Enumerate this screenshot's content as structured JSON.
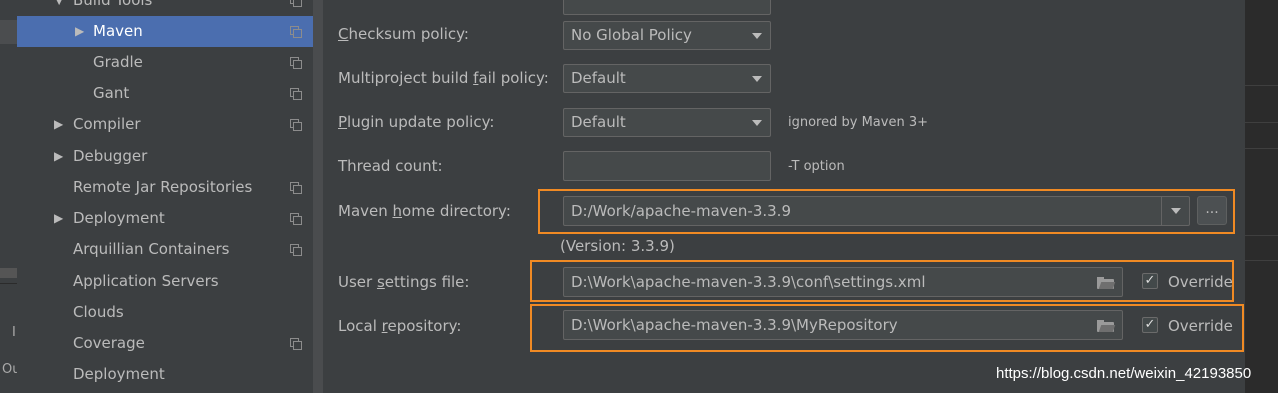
{
  "left_strip": {
    "text1": "I",
    "text2": "Ou"
  },
  "tree": {
    "partial_item": {
      "label": "Build Tools"
    },
    "items": [
      {
        "label": "Maven",
        "arrow": "▶",
        "selected": true,
        "icon": "copy-icon"
      },
      {
        "label": "Gradle",
        "arrow": "",
        "icon": "copy-icon"
      },
      {
        "label": "Gant",
        "arrow": "",
        "icon": "copy-icon"
      },
      {
        "label": "Compiler",
        "arrow": "▶",
        "icon": "copy-icon"
      },
      {
        "label": "Debugger",
        "arrow": "▶",
        "icon": ""
      },
      {
        "label": "Remote Jar Repositories",
        "arrow": "",
        "icon": "copy-icon"
      },
      {
        "label": "Deployment",
        "arrow": "▶",
        "icon": "copy-icon"
      },
      {
        "label": "Arquillian Containers",
        "arrow": "",
        "icon": "copy-icon"
      },
      {
        "label": "Application Servers",
        "arrow": "",
        "icon": ""
      },
      {
        "label": "Clouds",
        "arrow": "",
        "icon": ""
      },
      {
        "label": "Coverage",
        "arrow": "",
        "icon": "copy-icon"
      },
      {
        "label": "Deployment",
        "arrow": "",
        "icon": ""
      }
    ]
  },
  "settings": {
    "checksum_policy": {
      "label_pre": "",
      "label_mnemonic": "C",
      "label_post": "hecksum policy:",
      "value": "No Global Policy"
    },
    "multiproject_fail_policy": {
      "label_pre": "Multiproject build ",
      "label_mnemonic": "f",
      "label_post": "ail policy:",
      "value": "Default"
    },
    "plugin_update_policy": {
      "label_pre": "",
      "label_mnemonic": "P",
      "label_post": "lugin update policy:",
      "value": "Default",
      "hint": "ignored by Maven 3+"
    },
    "thread_count": {
      "label": "Thread count:",
      "value": "",
      "hint": "-T option"
    },
    "maven_home": {
      "label_pre": "Maven ",
      "label_mnemonic": "h",
      "label_post": "ome directory:",
      "value": "D:/Work/apache-maven-3.3.9",
      "browse_label": "...",
      "version": "(Version: 3.3.9)"
    },
    "user_settings": {
      "label_pre": "User ",
      "label_mnemonic": "s",
      "label_post": "ettings file:",
      "value": "D:\\Work\\apache-maven-3.3.9\\conf\\settings.xml",
      "override_label": "Override",
      "override_checked": true
    },
    "local_repository": {
      "label_pre": "Local ",
      "label_mnemonic": "r",
      "label_post": "epository:",
      "value": "D:\\Work\\apache-maven-3.3.9\\MyRepository",
      "override_label": "Override",
      "override_checked": true
    }
  },
  "check_glyph": "✓",
  "watermark": "https://blog.csdn.net/weixin_42193850",
  "colors": {
    "selection": "#4b6eaf",
    "highlight_box": "#f08a24",
    "background": "#3c3f41"
  }
}
